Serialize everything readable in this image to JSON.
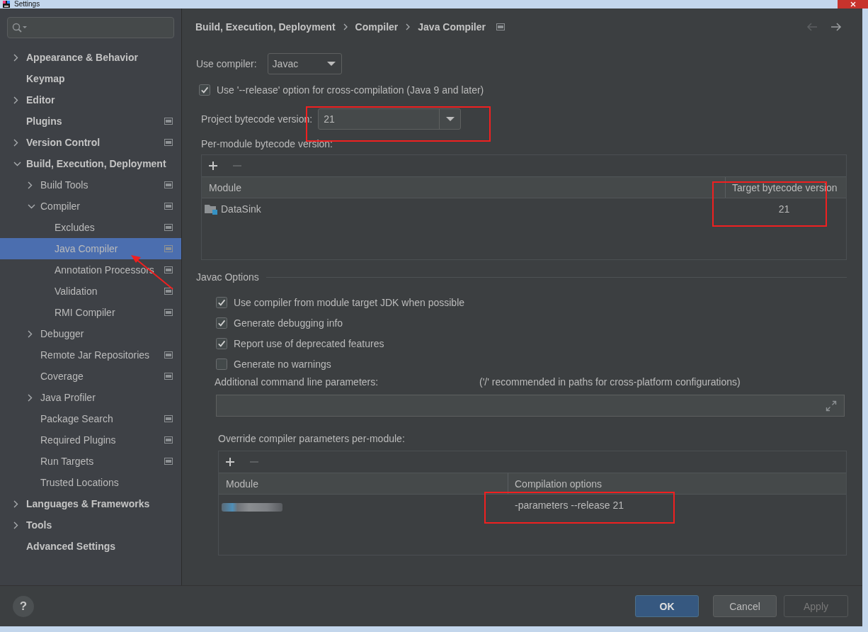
{
  "window": {
    "title": "Settings"
  },
  "sidebar": {
    "items": [
      {
        "label": "Appearance & Behavior",
        "expanded": false,
        "selected": false,
        "project_scoped": false
      },
      {
        "label": "Keymap",
        "selected": false,
        "project_scoped": false
      },
      {
        "label": "Editor",
        "expanded": false,
        "selected": false,
        "project_scoped": false
      },
      {
        "label": "Plugins",
        "selected": false,
        "project_scoped": true
      },
      {
        "label": "Version Control",
        "expanded": false,
        "selected": false,
        "project_scoped": true
      },
      {
        "label": "Build, Execution, Deployment",
        "expanded": true,
        "selected": false,
        "project_scoped": false,
        "children": [
          {
            "label": "Build Tools",
            "expanded": false,
            "selected": false,
            "project_scoped": true
          },
          {
            "label": "Compiler",
            "expanded": true,
            "selected": false,
            "project_scoped": true,
            "children": [
              {
                "label": "Excludes",
                "selected": false,
                "project_scoped": true
              },
              {
                "label": "Java Compiler",
                "selected": true,
                "project_scoped": true
              },
              {
                "label": "Annotation Processors",
                "selected": false,
                "project_scoped": true
              },
              {
                "label": "Validation",
                "selected": false,
                "project_scoped": true
              },
              {
                "label": "RMI Compiler",
                "selected": false,
                "project_scoped": true
              }
            ]
          },
          {
            "label": "Debugger",
            "expanded": false,
            "selected": false,
            "project_scoped": false
          },
          {
            "label": "Remote Jar Repositories",
            "selected": false,
            "project_scoped": true
          },
          {
            "label": "Coverage",
            "selected": false,
            "project_scoped": true
          },
          {
            "label": "Java Profiler",
            "expanded": false,
            "selected": false,
            "project_scoped": false
          },
          {
            "label": "Package Search",
            "selected": false,
            "project_scoped": true
          },
          {
            "label": "Required Plugins",
            "selected": false,
            "project_scoped": true
          },
          {
            "label": "Run Targets",
            "selected": false,
            "project_scoped": true
          },
          {
            "label": "Trusted Locations",
            "selected": false,
            "project_scoped": false
          }
        ]
      },
      {
        "label": "Languages & Frameworks",
        "expanded": false,
        "selected": false,
        "project_scoped": false
      },
      {
        "label": "Tools",
        "expanded": false,
        "selected": false,
        "project_scoped": false
      },
      {
        "label": "Advanced Settings",
        "selected": false,
        "project_scoped": false
      }
    ]
  },
  "breadcrumb": {
    "items": [
      "Build, Execution, Deployment",
      "Compiler",
      "Java Compiler"
    ],
    "project_scoped": true
  },
  "navigation": {
    "back_disabled": true,
    "forward_disabled": false
  },
  "use_compiler": {
    "label": "Use compiler:",
    "value": "Javac"
  },
  "release_option": {
    "label": "Use '--release' option for cross-compilation (Java 9 and later)",
    "checked": true
  },
  "project_bytecode": {
    "label": "Project bytecode version:",
    "value": "21"
  },
  "per_module_bytecode": {
    "label": "Per-module bytecode version:",
    "toolbar": [
      {
        "kind": "add",
        "disabled": false
      },
      {
        "kind": "remove",
        "disabled": true
      }
    ],
    "columns": [
      "Module",
      "Target bytecode version"
    ],
    "rows": [
      {
        "module": "DataSink",
        "version": "21"
      }
    ]
  },
  "javac_options": {
    "title": "Javac Options",
    "options": [
      {
        "label": "Use compiler from module target JDK when possible",
        "checked": true
      },
      {
        "label": "Generate debugging info",
        "checked": true
      },
      {
        "label": "Report use of deprecated features",
        "checked": true
      },
      {
        "label": "Generate no warnings",
        "checked": false
      }
    ],
    "additional_parameters": {
      "label": "Additional command line parameters:",
      "hint": "('/' recommended in paths for cross-platform configurations)"
    },
    "override": {
      "label": "Override compiler parameters per-module:",
      "toolbar": [
        {
          "kind": "add",
          "disabled": false
        },
        {
          "kind": "remove",
          "disabled": true
        }
      ],
      "columns": [
        "Module",
        "Compilation options"
      ],
      "rows": [
        {
          "module_blurred": true,
          "options": "-parameters --release 21"
        }
      ]
    }
  },
  "footer": {
    "help": "?",
    "buttons": [
      {
        "label": "OK",
        "kind": "ok",
        "disabled": false
      },
      {
        "label": "Cancel",
        "kind": "cancel",
        "disabled": false
      },
      {
        "label": "Apply",
        "kind": "apply",
        "disabled": true
      }
    ]
  }
}
